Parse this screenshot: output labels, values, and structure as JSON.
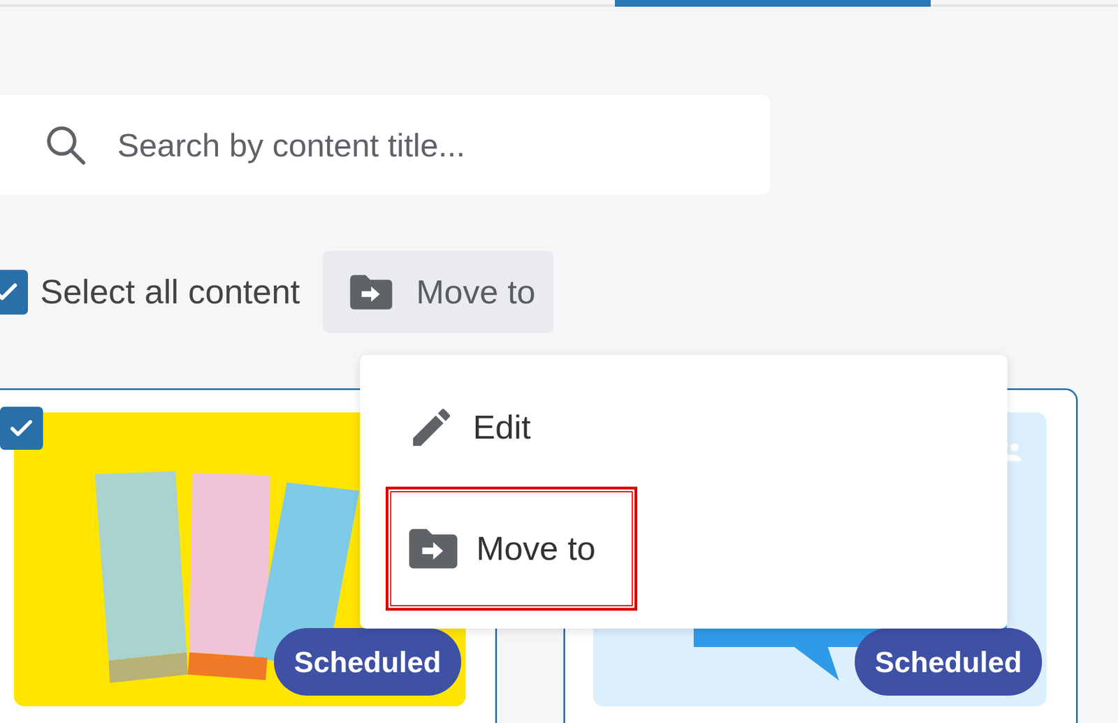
{
  "tabs": [
    {
      "selected": false
    },
    {
      "selected": true
    }
  ],
  "search": {
    "placeholder": "Search by content title..."
  },
  "select_all": {
    "label": "Select all content",
    "checked": true
  },
  "toolbar": {
    "move_button": "Move to"
  },
  "menu": {
    "items": [
      {
        "label": "Edit",
        "highlighted": false,
        "kind": "edit"
      },
      {
        "label": "Move to",
        "highlighted": true,
        "kind": "move"
      }
    ]
  },
  "cards": [
    {
      "selected": true,
      "checked": true,
      "badge": "Scheduled"
    },
    {
      "selected": true,
      "checked": true,
      "badge": "Scheduled"
    }
  ]
}
